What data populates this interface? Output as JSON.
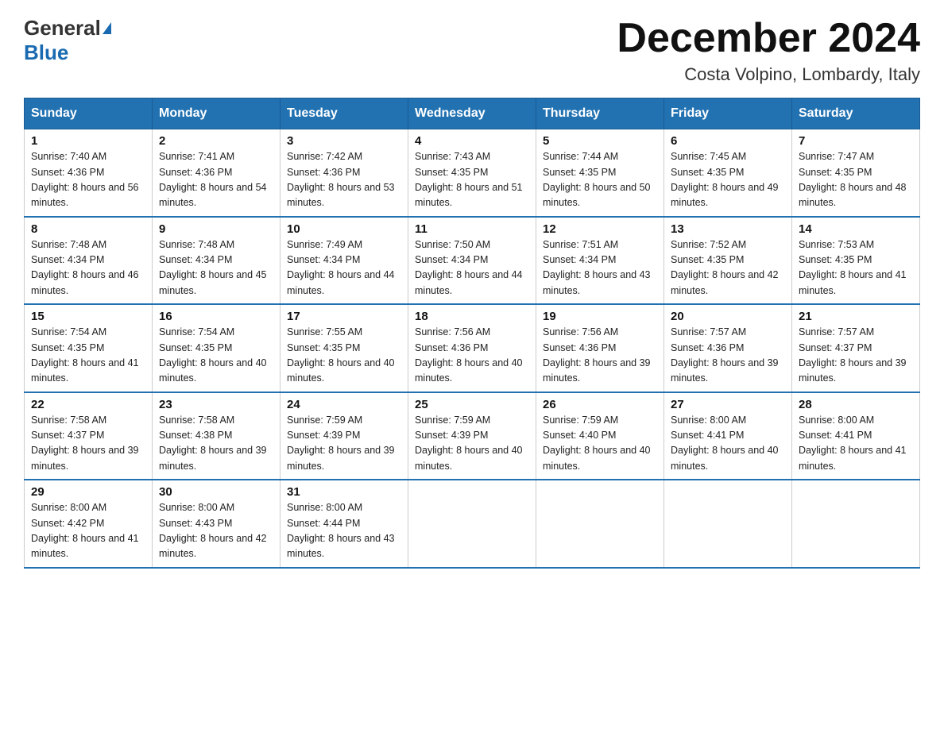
{
  "header": {
    "logo_general": "General",
    "logo_blue": "Blue",
    "title": "December 2024",
    "subtitle": "Costa Volpino, Lombardy, Italy"
  },
  "days_of_week": [
    "Sunday",
    "Monday",
    "Tuesday",
    "Wednesday",
    "Thursday",
    "Friday",
    "Saturday"
  ],
  "weeks": [
    [
      {
        "day": "1",
        "sunrise": "7:40 AM",
        "sunset": "4:36 PM",
        "daylight": "8 hours and 56 minutes."
      },
      {
        "day": "2",
        "sunrise": "7:41 AM",
        "sunset": "4:36 PM",
        "daylight": "8 hours and 54 minutes."
      },
      {
        "day": "3",
        "sunrise": "7:42 AM",
        "sunset": "4:36 PM",
        "daylight": "8 hours and 53 minutes."
      },
      {
        "day": "4",
        "sunrise": "7:43 AM",
        "sunset": "4:35 PM",
        "daylight": "8 hours and 51 minutes."
      },
      {
        "day": "5",
        "sunrise": "7:44 AM",
        "sunset": "4:35 PM",
        "daylight": "8 hours and 50 minutes."
      },
      {
        "day": "6",
        "sunrise": "7:45 AM",
        "sunset": "4:35 PM",
        "daylight": "8 hours and 49 minutes."
      },
      {
        "day": "7",
        "sunrise": "7:47 AM",
        "sunset": "4:35 PM",
        "daylight": "8 hours and 48 minutes."
      }
    ],
    [
      {
        "day": "8",
        "sunrise": "7:48 AM",
        "sunset": "4:34 PM",
        "daylight": "8 hours and 46 minutes."
      },
      {
        "day": "9",
        "sunrise": "7:48 AM",
        "sunset": "4:34 PM",
        "daylight": "8 hours and 45 minutes."
      },
      {
        "day": "10",
        "sunrise": "7:49 AM",
        "sunset": "4:34 PM",
        "daylight": "8 hours and 44 minutes."
      },
      {
        "day": "11",
        "sunrise": "7:50 AM",
        "sunset": "4:34 PM",
        "daylight": "8 hours and 44 minutes."
      },
      {
        "day": "12",
        "sunrise": "7:51 AM",
        "sunset": "4:34 PM",
        "daylight": "8 hours and 43 minutes."
      },
      {
        "day": "13",
        "sunrise": "7:52 AM",
        "sunset": "4:35 PM",
        "daylight": "8 hours and 42 minutes."
      },
      {
        "day": "14",
        "sunrise": "7:53 AM",
        "sunset": "4:35 PM",
        "daylight": "8 hours and 41 minutes."
      }
    ],
    [
      {
        "day": "15",
        "sunrise": "7:54 AM",
        "sunset": "4:35 PM",
        "daylight": "8 hours and 41 minutes."
      },
      {
        "day": "16",
        "sunrise": "7:54 AM",
        "sunset": "4:35 PM",
        "daylight": "8 hours and 40 minutes."
      },
      {
        "day": "17",
        "sunrise": "7:55 AM",
        "sunset": "4:35 PM",
        "daylight": "8 hours and 40 minutes."
      },
      {
        "day": "18",
        "sunrise": "7:56 AM",
        "sunset": "4:36 PM",
        "daylight": "8 hours and 40 minutes."
      },
      {
        "day": "19",
        "sunrise": "7:56 AM",
        "sunset": "4:36 PM",
        "daylight": "8 hours and 39 minutes."
      },
      {
        "day": "20",
        "sunrise": "7:57 AM",
        "sunset": "4:36 PM",
        "daylight": "8 hours and 39 minutes."
      },
      {
        "day": "21",
        "sunrise": "7:57 AM",
        "sunset": "4:37 PM",
        "daylight": "8 hours and 39 minutes."
      }
    ],
    [
      {
        "day": "22",
        "sunrise": "7:58 AM",
        "sunset": "4:37 PM",
        "daylight": "8 hours and 39 minutes."
      },
      {
        "day": "23",
        "sunrise": "7:58 AM",
        "sunset": "4:38 PM",
        "daylight": "8 hours and 39 minutes."
      },
      {
        "day": "24",
        "sunrise": "7:59 AM",
        "sunset": "4:39 PM",
        "daylight": "8 hours and 39 minutes."
      },
      {
        "day": "25",
        "sunrise": "7:59 AM",
        "sunset": "4:39 PM",
        "daylight": "8 hours and 40 minutes."
      },
      {
        "day": "26",
        "sunrise": "7:59 AM",
        "sunset": "4:40 PM",
        "daylight": "8 hours and 40 minutes."
      },
      {
        "day": "27",
        "sunrise": "8:00 AM",
        "sunset": "4:41 PM",
        "daylight": "8 hours and 40 minutes."
      },
      {
        "day": "28",
        "sunrise": "8:00 AM",
        "sunset": "4:41 PM",
        "daylight": "8 hours and 41 minutes."
      }
    ],
    [
      {
        "day": "29",
        "sunrise": "8:00 AM",
        "sunset": "4:42 PM",
        "daylight": "8 hours and 41 minutes."
      },
      {
        "day": "30",
        "sunrise": "8:00 AM",
        "sunset": "4:43 PM",
        "daylight": "8 hours and 42 minutes."
      },
      {
        "day": "31",
        "sunrise": "8:00 AM",
        "sunset": "4:44 PM",
        "daylight": "8 hours and 43 minutes."
      },
      {
        "day": "",
        "sunrise": "",
        "sunset": "",
        "daylight": ""
      },
      {
        "day": "",
        "sunrise": "",
        "sunset": "",
        "daylight": ""
      },
      {
        "day": "",
        "sunrise": "",
        "sunset": "",
        "daylight": ""
      },
      {
        "day": "",
        "sunrise": "",
        "sunset": "",
        "daylight": ""
      }
    ]
  ],
  "labels": {
    "sunrise": "Sunrise: ",
    "sunset": "Sunset: ",
    "daylight": "Daylight: "
  }
}
